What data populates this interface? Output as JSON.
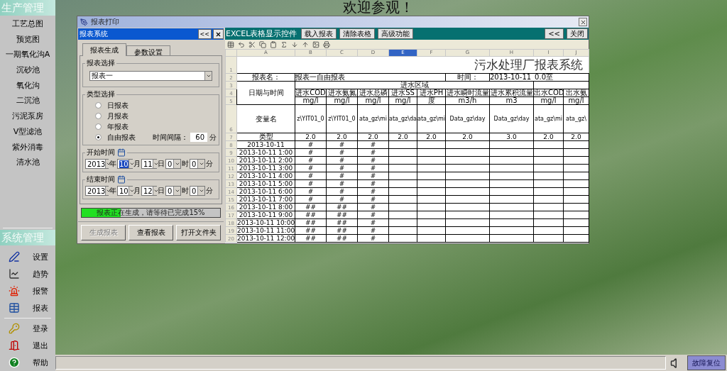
{
  "sidebar": {
    "production": {
      "title": "生产管理",
      "items": [
        "工艺总图",
        "预览图",
        "一期氧化沟A",
        "沉砂池",
        "氧化沟",
        "二沉池",
        "污泥泵房",
        "V型滤池",
        "紫外消毒",
        "清水池"
      ]
    },
    "system": {
      "title": "系统管理",
      "items": [
        "设置",
        "趋势",
        "报警",
        "报表"
      ],
      "session_items": [
        "登录",
        "退出",
        "帮助"
      ]
    }
  },
  "welcome": "欢迎参观！",
  "dialog": {
    "title": "报表打印",
    "panel": {
      "title": "报表系统",
      "collapse": "<<",
      "tabs": [
        {
          "label": "报表生成",
          "selected": true
        },
        {
          "label": "参数设置",
          "selected": false
        }
      ],
      "report_select": {
        "label": "报表选择",
        "value": "报表一"
      },
      "type_select": {
        "label": "类型选择",
        "options": [
          {
            "label": "日报表",
            "selected": false
          },
          {
            "label": "月报表",
            "selected": false
          },
          {
            "label": "年报表",
            "selected": false
          },
          {
            "label": "自由报表",
            "selected": true
          }
        ],
        "interval_label": "时间间隔：",
        "interval": "60",
        "interval_unit": "分"
      },
      "start": {
        "label": "开始时间",
        "fields": [
          {
            "value": "2013",
            "unit": "年",
            "focused": false
          },
          {
            "value": "10",
            "unit": "月",
            "focused": true
          },
          {
            "value": "11",
            "unit": "日",
            "focused": false
          },
          {
            "value": "0",
            "unit": "时",
            "focused": false
          },
          {
            "value": "0",
            "unit": "分",
            "focused": false
          }
        ]
      },
      "end": {
        "label": "结束时间",
        "fields": [
          {
            "value": "2013",
            "unit": "年",
            "focused": false
          },
          {
            "value": "10",
            "unit": "月",
            "focused": false
          },
          {
            "value": "12",
            "unit": "日",
            "focused": false
          },
          {
            "value": "0",
            "unit": "时",
            "focused": false
          },
          {
            "value": "0",
            "unit": "分",
            "focused": false
          }
        ]
      },
      "progress": {
        "level": 0.28,
        "text": "报表正在生成，请等待已完成15%"
      },
      "buttons": [
        {
          "label": "生成报表",
          "disabled": true
        },
        {
          "label": "查看报表",
          "disabled": false
        },
        {
          "label": "打开文件夹",
          "disabled": false
        }
      ]
    },
    "viewer": {
      "title": "EXCEL表格显示控件",
      "buttons": [
        "载入报表",
        "清除表格",
        "高级功能"
      ],
      "collapse": "<<",
      "close": "关闭",
      "sheet": {
        "columns": [
          {
            "letter": "A",
            "selected": false
          },
          {
            "letter": "B",
            "selected": false
          },
          {
            "letter": "C",
            "selected": false
          },
          {
            "letter": "D",
            "selected": false
          },
          {
            "letter": "E",
            "selected": true
          },
          {
            "letter": "F",
            "selected": false
          },
          {
            "letter": "G",
            "selected": false
          },
          {
            "letter": "H",
            "selected": false
          },
          {
            "letter": "I",
            "selected": false
          },
          {
            "letter": "J",
            "selected": false
          }
        ],
        "title_row": "1",
        "title": "污水处理厂报表系统",
        "info_row": "2",
        "report_name_label": "报表名：",
        "report_name": "报表一自由报表",
        "time_label": "时间：",
        "time_value": "2013-10-11_0.0至",
        "group_rows": [
          "3",
          "4",
          "5"
        ],
        "date_time_label": "日期与时间",
        "group_label": "进水区域",
        "headers": [
          "进水COD",
          "进水氨氮",
          "进水总磷",
          "进水SS",
          "进水PH",
          "进水瞬时流量",
          "进水累积流量",
          "出水COD",
          "出水氨"
        ],
        "units": [
          "mg/l",
          "mg/l",
          "mg/l",
          "mg/l",
          "度",
          "m3/h",
          "m3",
          "mg/l",
          "mg/l"
        ],
        "var_row": "6",
        "var_label": "变量名",
        "vars": [
          "z\\YIT01_0",
          "z\\YIT01_0",
          "ata_gz\\mi",
          "ata_gz\\da",
          "ata_gz\\mi",
          "Data_gz\\day",
          "Data_gz\\day",
          "ata_gz\\mi",
          "ata_gz\\"
        ],
        "type_row": "7",
        "type_label": "类型",
        "types": [
          "2.0",
          "2.0",
          "2.0",
          "2.0",
          "2.0",
          "2.0",
          "3.0",
          "2.0",
          "2.0"
        ],
        "data_rows": [
          {
            "row": "8",
            "time": "2013-10-11",
            "values": [
              "#",
              "#",
              "#"
            ]
          },
          {
            "row": "9",
            "time": "2013-10-11 1:00",
            "values": [
              "#",
              "#",
              "#"
            ]
          },
          {
            "row": "10",
            "time": "2013-10-11 2:00",
            "values": [
              "#",
              "#",
              "#"
            ]
          },
          {
            "row": "11",
            "time": "2013-10-11 3:00",
            "values": [
              "#",
              "#",
              "#"
            ]
          },
          {
            "row": "12",
            "time": "2013-10-11 4:00",
            "values": [
              "#",
              "#",
              "#"
            ]
          },
          {
            "row": "13",
            "time": "2013-10-11 5:00",
            "values": [
              "#",
              "#",
              "#"
            ]
          },
          {
            "row": "14",
            "time": "2013-10-11 6:00",
            "values": [
              "#",
              "#",
              "#"
            ]
          },
          {
            "row": "15",
            "time": "2013-10-11 7:00",
            "values": [
              "#",
              "#",
              "#"
            ]
          },
          {
            "row": "16",
            "time": "2013-10-11 8:00",
            "values": [
              "##",
              "##",
              "#"
            ]
          },
          {
            "row": "17",
            "time": "2013-10-11 9:00",
            "values": [
              "##",
              "##",
              "#"
            ]
          },
          {
            "row": "18",
            "time": "2013-10-11 10:00",
            "values": [
              "##",
              "##",
              "#"
            ]
          },
          {
            "row": "19",
            "time": "2013-10-11 11:00",
            "values": [
              "##",
              "##",
              "#"
            ]
          },
          {
            "row": "20",
            "time": "2013-10-11 12:00",
            "values": [
              "##",
              "##",
              "#"
            ]
          }
        ]
      }
    }
  },
  "status_bar": {
    "reset_button": "故障复位"
  }
}
